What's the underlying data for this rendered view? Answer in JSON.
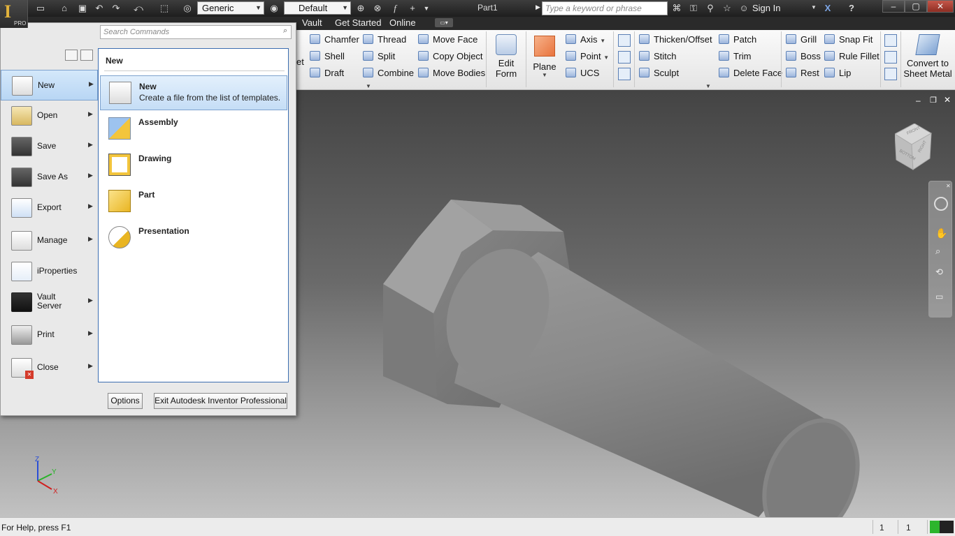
{
  "app": {
    "badge": "PRO",
    "letter": "I"
  },
  "toolbar": {
    "material": "Generic",
    "appearance": "Default",
    "fx": "f"
  },
  "document": {
    "title": "Part1"
  },
  "help_search": {
    "placeholder": "Type a keyword or phrase"
  },
  "user": {
    "signin_label": "Sign In"
  },
  "tabs": [
    "Vault",
    "Get Started",
    "Online"
  ],
  "ribbon": {
    "modify": [
      "Chamfer",
      "Shell",
      "Draft",
      "Thread",
      "Split",
      "Combine",
      "Move Face",
      "Copy Object",
      "Move Bodies"
    ],
    "edit_form": "Edit Form",
    "plane": "Plane",
    "work_features": [
      "Axis",
      "Point",
      "UCS"
    ],
    "surface": [
      "Thicken/Offset",
      "Stitch",
      "Sculpt",
      "Patch",
      "Trim",
      "Delete Face"
    ],
    "plastic": [
      "Grill",
      "Boss",
      "Rest",
      "Snap Fit",
      "Rule Fillet",
      "Lip"
    ],
    "convert": "Convert to Sheet Metal",
    "partial_label": "et"
  },
  "app_menu": {
    "search_placeholder": "Search Commands",
    "left_items": [
      "New",
      "Open",
      "Save",
      "Save As",
      "Export",
      "Manage",
      "iProperties",
      "Vault Server",
      "Print",
      "Close"
    ],
    "submenu_title": "New",
    "submenu_items": [
      {
        "title": "New",
        "desc": "Create a file from the list of templates."
      },
      {
        "title": "Assembly",
        "desc": ""
      },
      {
        "title": "Drawing",
        "desc": ""
      },
      {
        "title": "Part",
        "desc": ""
      },
      {
        "title": "Presentation",
        "desc": ""
      }
    ],
    "options_label": "Options",
    "exit_label": "Exit Autodesk Inventor Professional"
  },
  "viewcube": {
    "faces": [
      "FRONT",
      "BOTTOM",
      "RIGHT"
    ]
  },
  "axes": {
    "x": "X",
    "y": "Y",
    "z": "Z"
  },
  "status": {
    "help": "For Help, press F1",
    "count1": "1",
    "count2": "1"
  },
  "colors": {
    "accent": "#3c6db0",
    "selection": "#c5ddf6",
    "model": "#8a8a8a",
    "status_green": "#2db52d"
  }
}
